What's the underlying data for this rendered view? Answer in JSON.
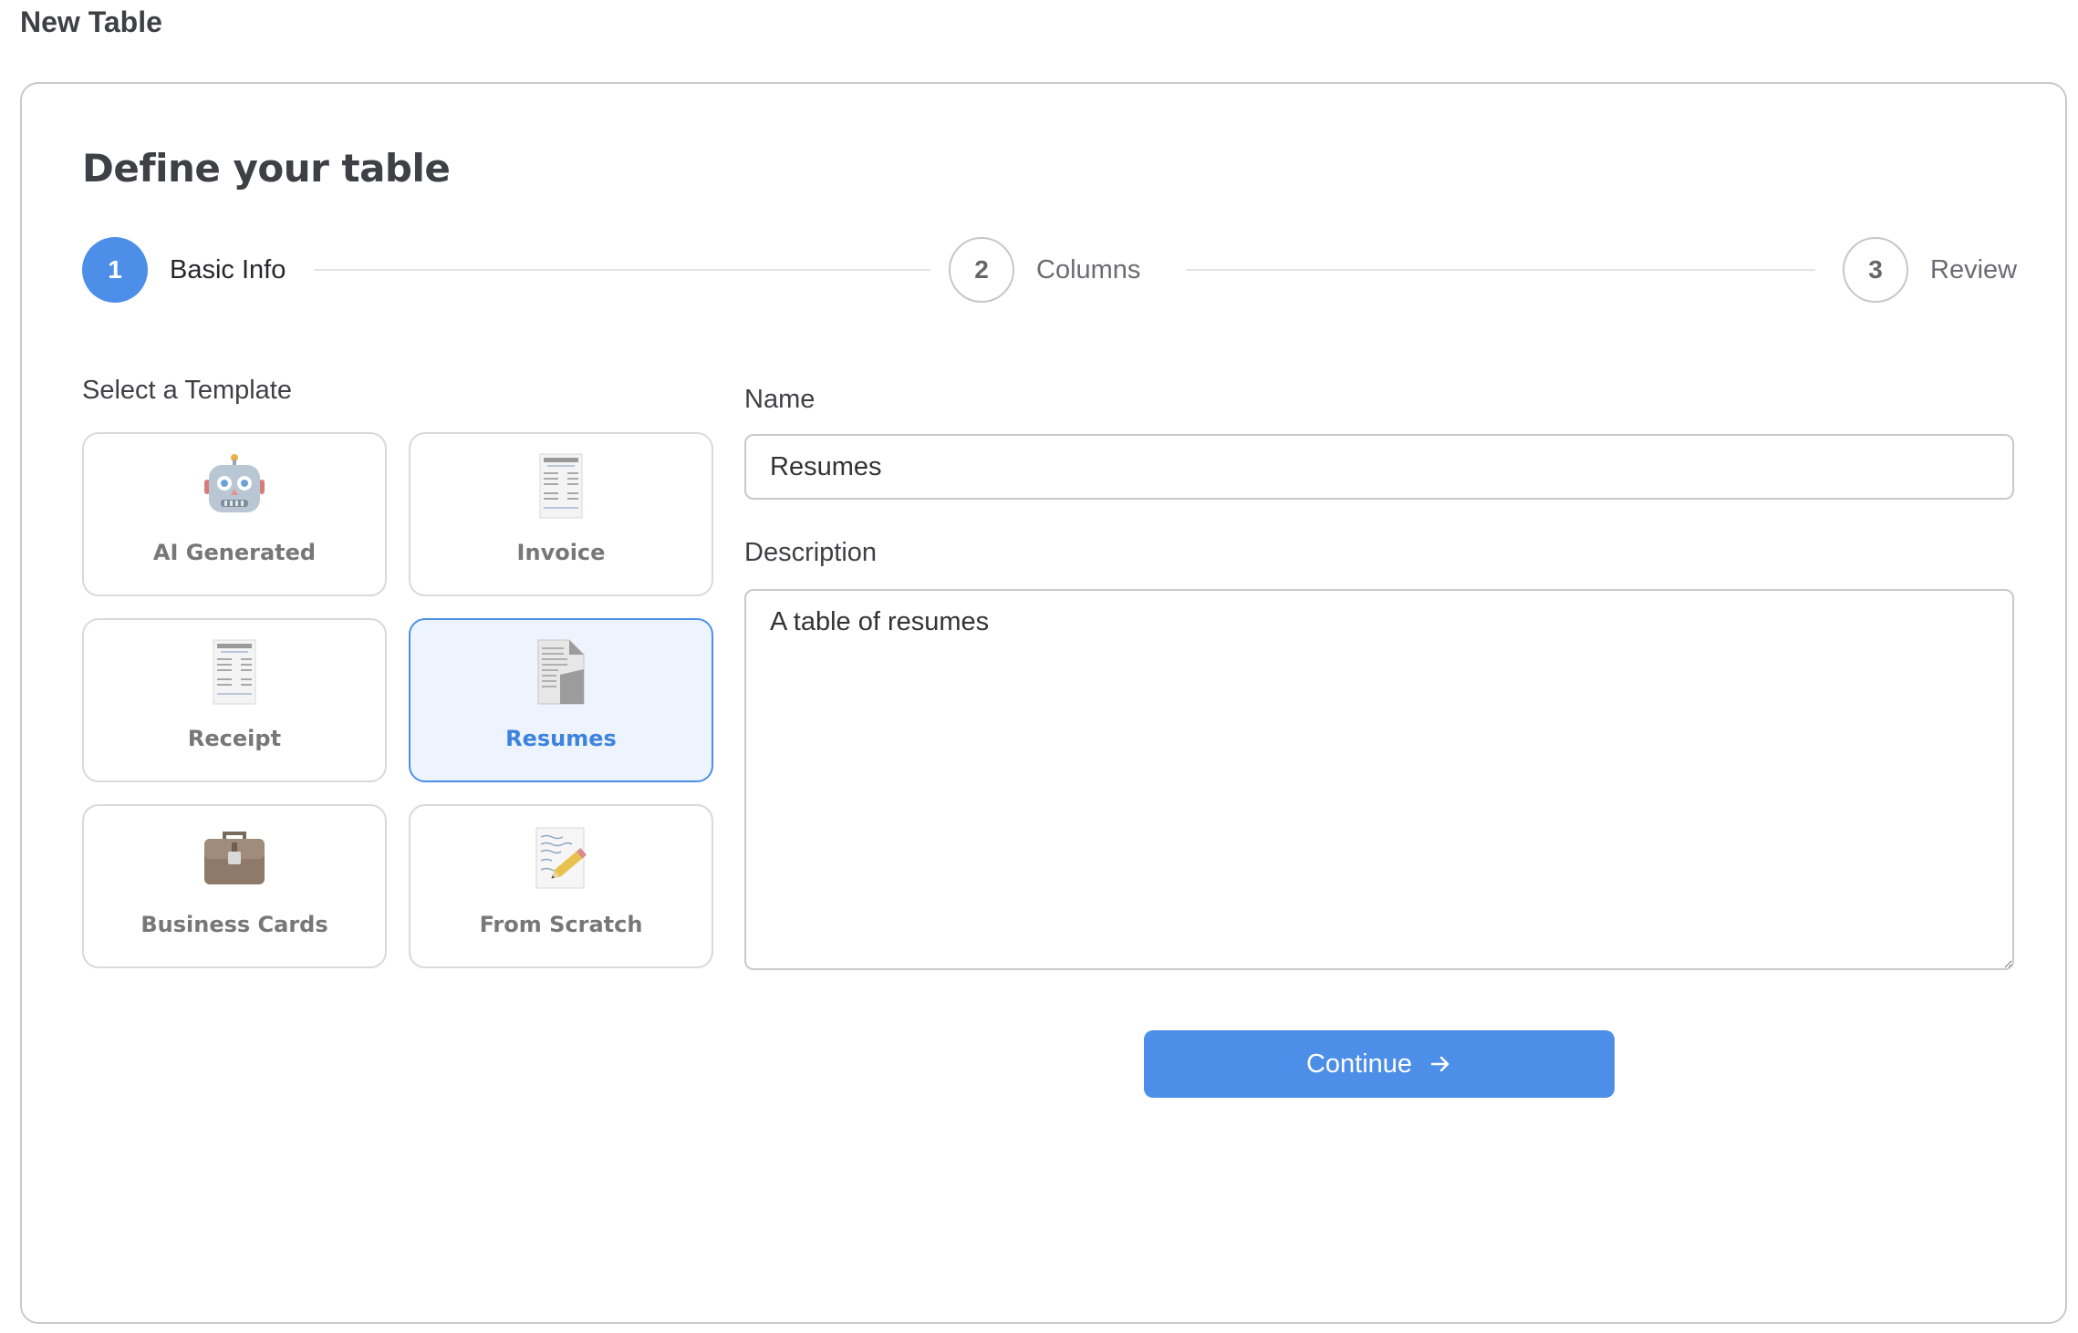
{
  "page": {
    "title": "New Table"
  },
  "card": {
    "heading": "Define your table"
  },
  "stepper": {
    "steps": [
      {
        "number": "1",
        "label": "Basic Info",
        "active": true
      },
      {
        "number": "2",
        "label": "Columns",
        "active": false
      },
      {
        "number": "3",
        "label": "Review",
        "active": false
      }
    ]
  },
  "templates": {
    "label": "Select a Template",
    "items": [
      {
        "label": "AI Generated",
        "icon": "robot-icon"
      },
      {
        "label": "Invoice",
        "icon": "invoice-icon"
      },
      {
        "label": "Receipt",
        "icon": "receipt-icon"
      },
      {
        "label": "Resumes",
        "icon": "document-icon",
        "selected": true
      },
      {
        "label": "Business Cards",
        "icon": "briefcase-icon"
      },
      {
        "label": "From Scratch",
        "icon": "pencil-paper-icon"
      }
    ]
  },
  "form": {
    "name_label": "Name",
    "name_value": "Resumes",
    "description_label": "Description",
    "description_value": "A table of resumes",
    "continue_label": "Continue",
    "continue_icon": "arrow-right-icon"
  },
  "colors": {
    "accent": "#4d8fe8",
    "selected_bg": "#eef4fd"
  }
}
